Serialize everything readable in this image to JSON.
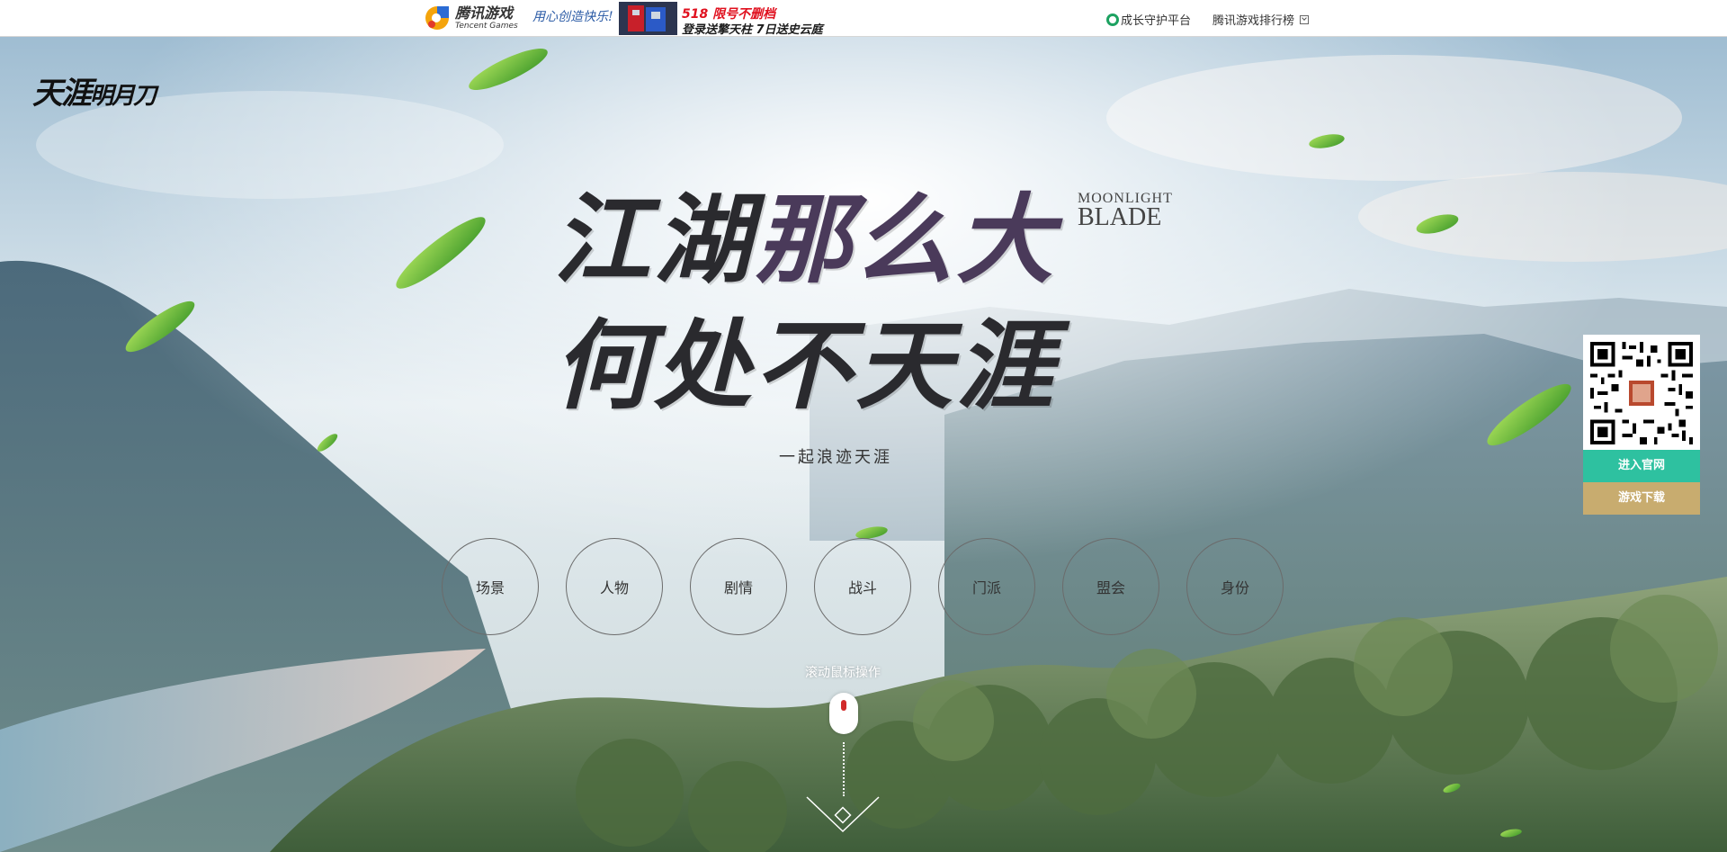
{
  "topbar": {
    "tencent_cn": "腾讯游戏",
    "tencent_en": "Tencent Games",
    "slogan": "用心创造快乐!",
    "promo_line1": "518 限号不删档",
    "promo_line2": "登录送擎天柱 7日送史云庭",
    "guard_link": "成长守护平台",
    "rank_link": "腾讯游戏排行榜",
    "guard_color": "#1da261"
  },
  "logo": {
    "text_main": "天涯",
    "text_sub": "明月刀"
  },
  "headline": {
    "line1_a": "江湖",
    "line1_b": "那么大",
    "line2": "何处不天涯",
    "en_small": "MOONLIGHT",
    "en_big": "BLADE",
    "tagline": "一起浪迹天涯"
  },
  "nav": {
    "items": [
      {
        "label": "场景"
      },
      {
        "label": "人物"
      },
      {
        "label": "剧情"
      },
      {
        "label": "战斗"
      },
      {
        "label": "门派"
      },
      {
        "label": "盟会"
      },
      {
        "label": "身份"
      }
    ]
  },
  "scroll": {
    "hint": "滚动鼠标操作"
  },
  "side": {
    "enter_site": "进入官网",
    "download": "游戏下载",
    "enter_color": "#2ec1a0",
    "download_color": "#c8ac6f"
  }
}
